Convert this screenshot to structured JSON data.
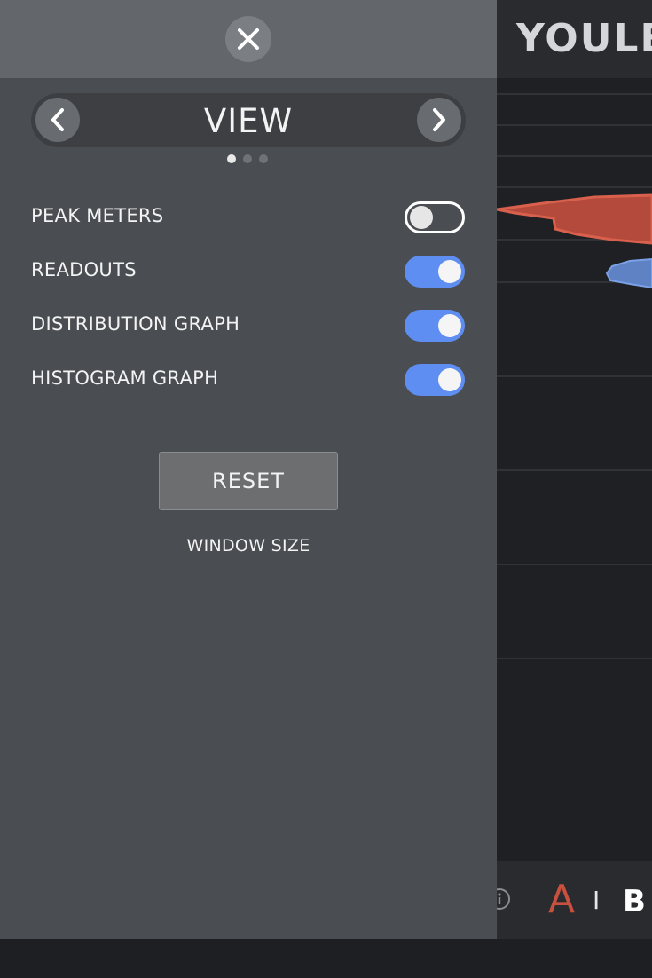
{
  "app": {
    "title": "YOULE",
    "footer": {
      "a_label": "A",
      "separator": "I",
      "b_label": "B"
    }
  },
  "colors": {
    "panel": "#4a4d51",
    "panel_header": "#63666a",
    "toggle_on": "#5e8ef2",
    "graph_red": "#c8503f",
    "graph_blue": "#6a8fd0"
  },
  "icons": {
    "close": "close-icon",
    "prev": "chevron-left-icon",
    "next": "chevron-right-icon",
    "info": "info-icon"
  },
  "settings_panel": {
    "title": "VIEW",
    "page_count": 3,
    "active_page": 1,
    "toggles": [
      {
        "label": "PEAK METERS",
        "on": false
      },
      {
        "label": "READOUTS",
        "on": true
      },
      {
        "label": "DISTRIBUTION GRAPH",
        "on": true
      },
      {
        "label": "HISTOGRAM GRAPH",
        "on": true
      }
    ],
    "reset_label": "RESET",
    "window_size_label": "WINDOW SIZE"
  }
}
